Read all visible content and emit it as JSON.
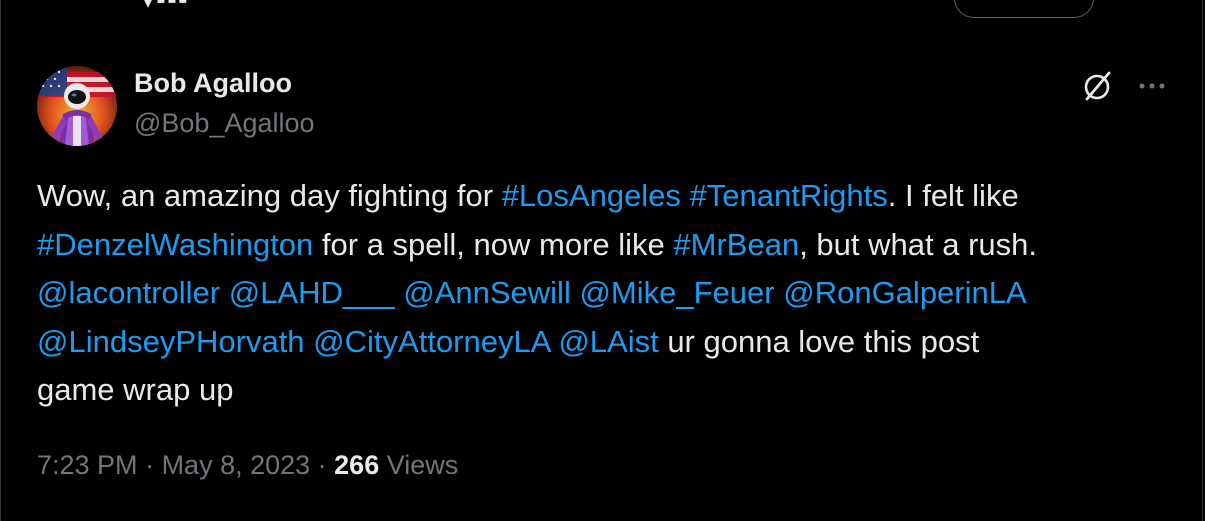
{
  "colors": {
    "background": "#000000",
    "text_primary": "#e7e9ea",
    "text_secondary": "#71767b",
    "link": "#1d9bf0",
    "border": "#2f3336"
  },
  "author": {
    "display_name": "Bob Agalloo",
    "handle": "@Bob_Agalloo",
    "avatar_icon": "astronaut-flag-avatar"
  },
  "actions": {
    "grok_icon": "grok-slash-circle-icon",
    "more_icon": "more-dots-icon"
  },
  "tweet": {
    "lines": [
      [
        {
          "type": "text",
          "text": "Wow, an amazing day fighting for "
        },
        {
          "type": "hashtag",
          "text": "#LosAngeles"
        },
        {
          "type": "text",
          "text": " "
        },
        {
          "type": "hashtag",
          "text": "#TenantRights"
        },
        {
          "type": "text",
          "text": ". I felt like"
        }
      ],
      [
        {
          "type": "hashtag",
          "text": "#DenzelWashington"
        },
        {
          "type": "text",
          "text": " for a spell, now more like "
        },
        {
          "type": "hashtag",
          "text": "#MrBean"
        },
        {
          "type": "text",
          "text": ", but what a rush."
        }
      ],
      [
        {
          "type": "mention",
          "text": "@lacontroller"
        },
        {
          "type": "text",
          "text": " "
        },
        {
          "type": "mention",
          "text": "@LAHD___"
        },
        {
          "type": "text",
          "text": " "
        },
        {
          "type": "mention",
          "text": "@AnnSewill"
        },
        {
          "type": "text",
          "text": " "
        },
        {
          "type": "mention",
          "text": "@Mike_Feuer"
        },
        {
          "type": "text",
          "text": " "
        },
        {
          "type": "mention",
          "text": "@RonGalperinLA"
        }
      ],
      [
        {
          "type": "mention",
          "text": "@LindseyPHorvath"
        },
        {
          "type": "text",
          "text": " "
        },
        {
          "type": "mention",
          "text": "@CityAttorneyLA"
        },
        {
          "type": "text",
          "text": " "
        },
        {
          "type": "mention",
          "text": "@LAist"
        },
        {
          "type": "text",
          "text": " ur gonna love this post"
        }
      ],
      [
        {
          "type": "text",
          "text": "game wrap up"
        }
      ]
    ]
  },
  "meta": {
    "time": "7:23 PM",
    "separator": " · ",
    "date": "May 8, 2023",
    "views_count": "266",
    "views_label": "Views"
  }
}
